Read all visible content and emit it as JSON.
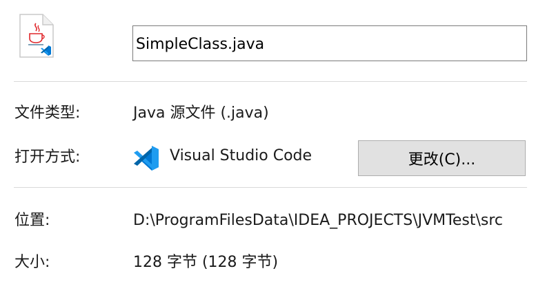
{
  "file": {
    "icon": "java-source-file-icon",
    "name": "SimpleClass.java"
  },
  "properties": {
    "file_type_label": "文件类型:",
    "file_type_value": "Java 源文件 (.java)",
    "opens_with_label": "打开方式:",
    "opens_with_app": "Visual Studio Code",
    "opens_with_icon": "vscode-icon",
    "change_button_label": "更改(C)...",
    "location_label": "位置:",
    "location_value": "D:\\ProgramFilesData\\IDEA_PROJECTS\\JVMTest\\src",
    "size_label": "大小:",
    "size_value": "128 字节 (128 字节)"
  },
  "colors": {
    "vscode_blue": "#0078d4",
    "java_red": "#e0262a",
    "divider": "#d9d9d9",
    "button_bg": "#e1e1e1"
  }
}
